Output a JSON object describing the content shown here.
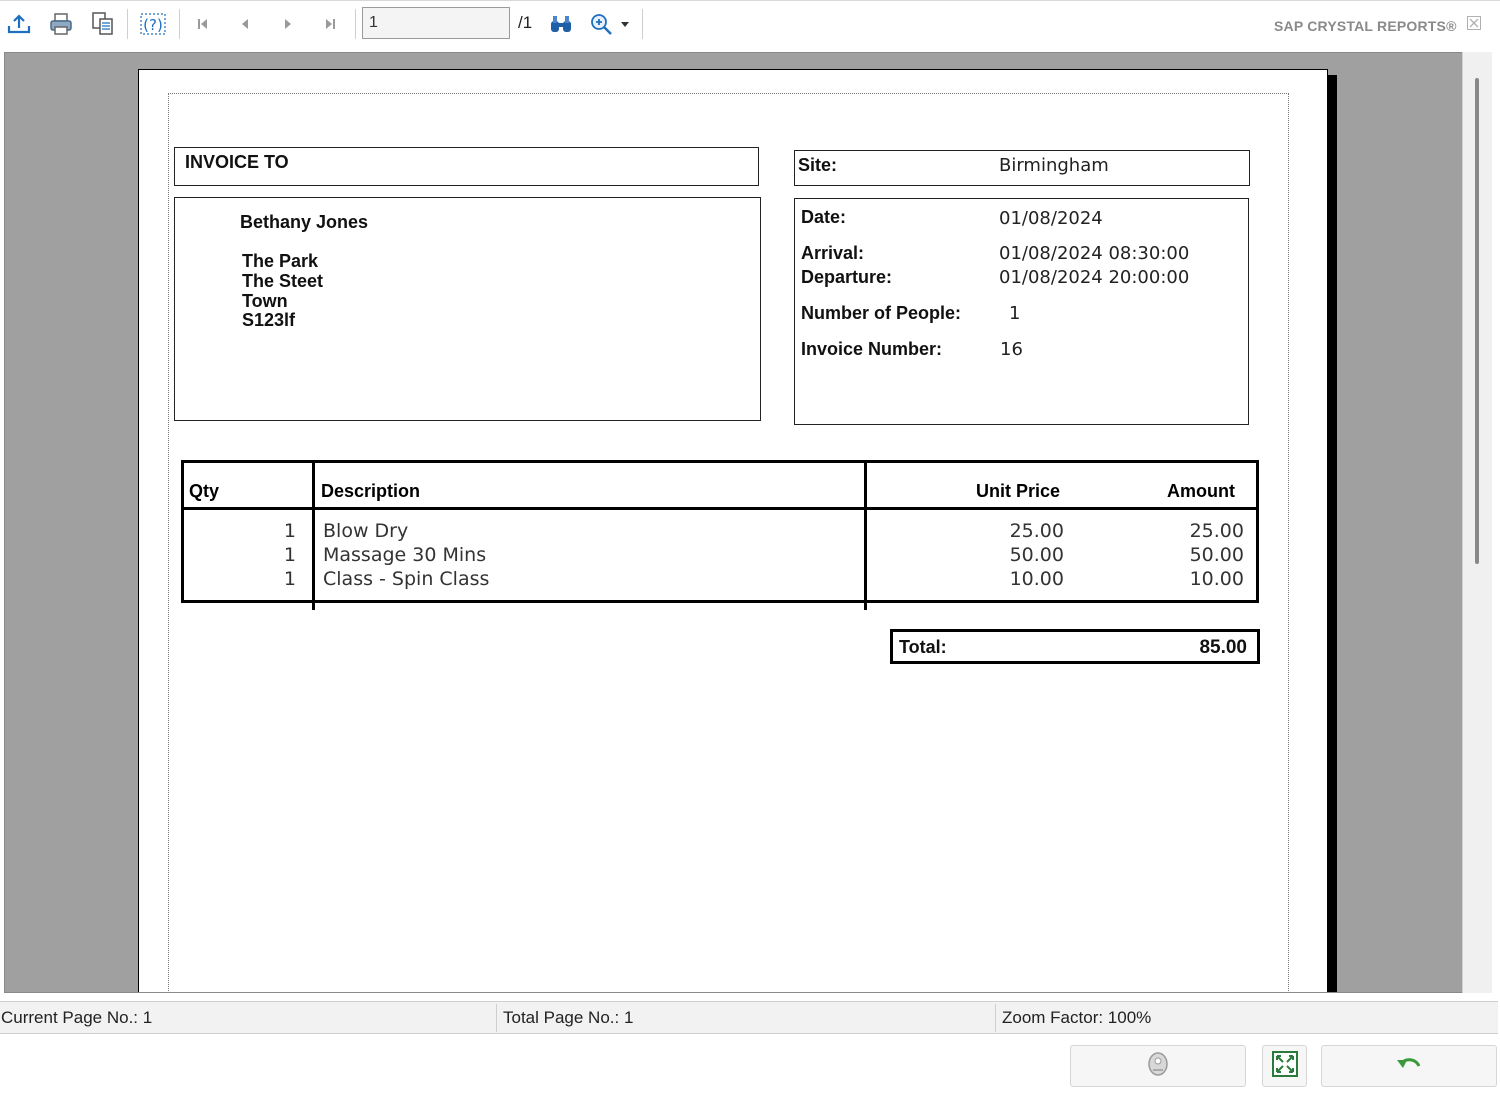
{
  "toolbar": {
    "page_input_value": "1",
    "page_total": "/1",
    "brand": "SAP CRYSTAL REPORTS®",
    "icons": [
      "export-icon",
      "print-icon",
      "copy-icon",
      "help-icon",
      "first-page-icon",
      "previous-page-icon",
      "next-page-icon",
      "last-page-icon",
      "find-icon",
      "zoom-icon",
      "dropdown-arrow-icon",
      "close-icon"
    ]
  },
  "report": {
    "invoice_to_label": "INVOICE TO",
    "customer": {
      "name": "Bethany Jones",
      "address_lines": [
        "The Park",
        "The Steet",
        "Town",
        "S123lf"
      ]
    },
    "site_label": "Site:",
    "site_value": "Birmingham",
    "date_label": "Date:",
    "date_value": "01/08/2024",
    "arrival_label": "Arrival:",
    "arrival_value": "01/08/2024 08:30:00",
    "departure_label": "Departure:",
    "departure_value": "01/08/2024 20:00:00",
    "people_label": "Number of People:",
    "people_value": "1",
    "invoice_number_label": "Invoice Number:",
    "invoice_number_value": "16",
    "table": {
      "headers": {
        "qty": "Qty",
        "description": "Description",
        "unit_price": "Unit Price",
        "amount": "Amount"
      },
      "rows": [
        {
          "qty": "1",
          "description": "Blow Dry",
          "unit_price": "25.00",
          "amount": "25.00"
        },
        {
          "qty": "1",
          "description": "Massage 30 Mins",
          "unit_price": "50.00",
          "amount": "50.00"
        },
        {
          "qty": "1",
          "description": "Class - Spin Class",
          "unit_price": "10.00",
          "amount": "10.00"
        }
      ]
    },
    "total_label": "Total:",
    "total_value": "85.00"
  },
  "statusbar": {
    "current_page": "Current Page No.: 1",
    "total_pages": "Total Page No.: 1",
    "zoom": "Zoom Factor: 100%"
  },
  "bottom_buttons": [
    "audit-icon",
    "fit-window-icon",
    "undo-icon"
  ],
  "colors": {
    "accent_blue": "#1f6fc1",
    "viewer_background": "#a0a0a0",
    "brand_gray": "#8a8a8a"
  }
}
